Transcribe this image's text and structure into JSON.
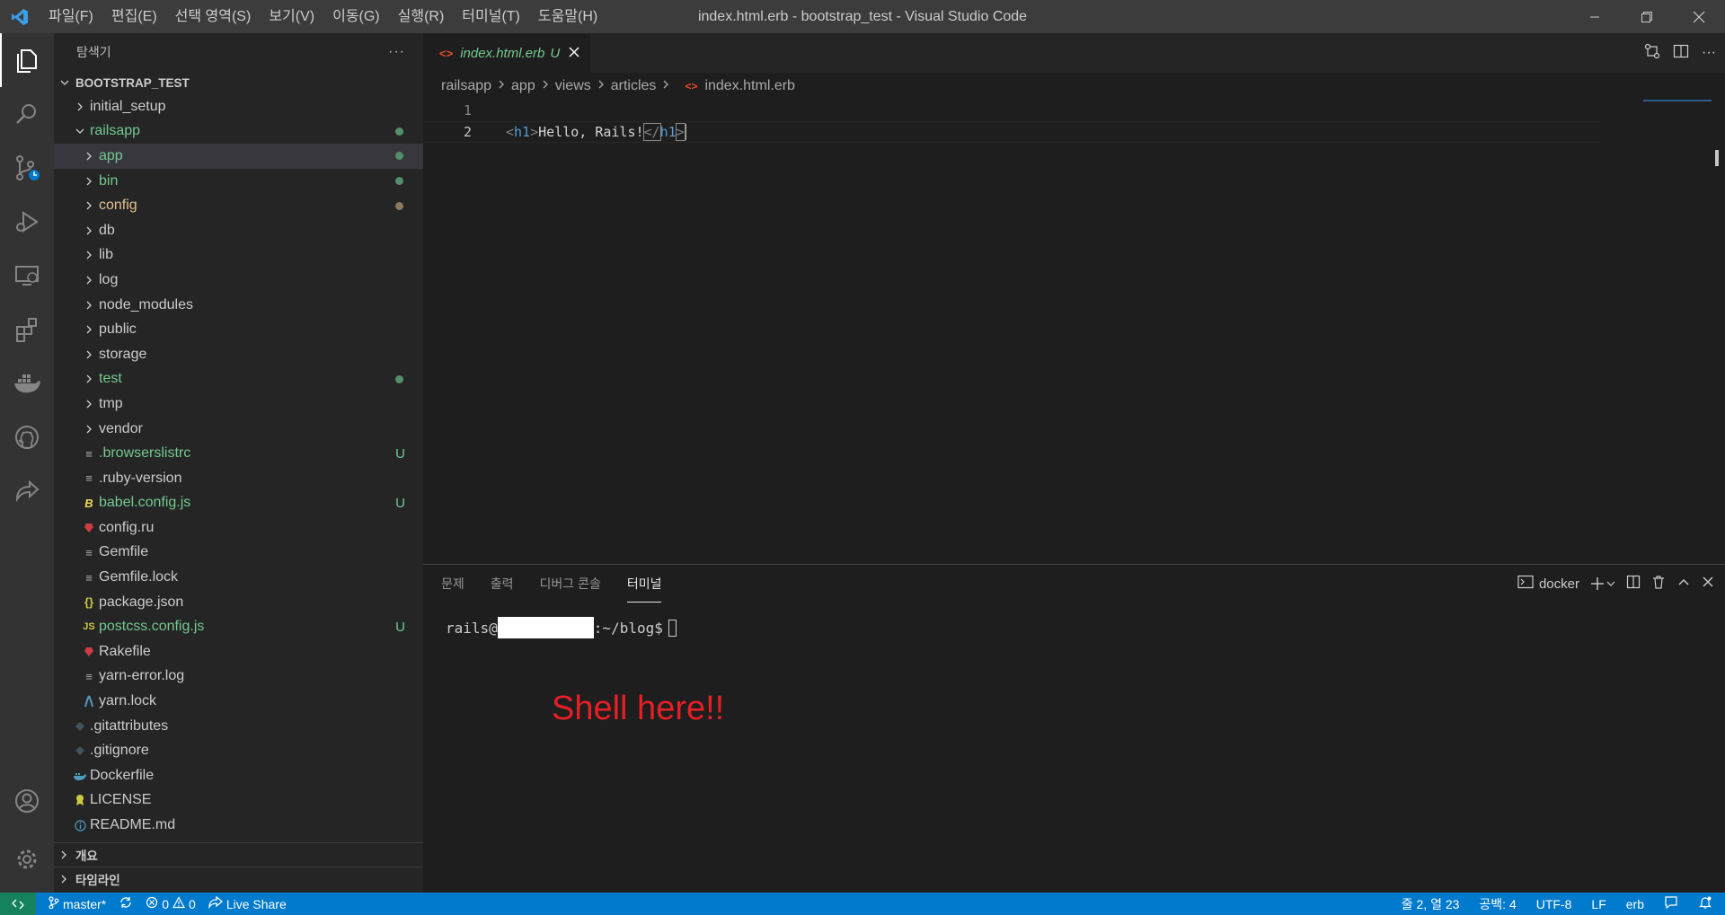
{
  "menu": [
    "파일(F)",
    "편집(E)",
    "선택 영역(S)",
    "보기(V)",
    "이동(G)",
    "실행(R)",
    "터미널(T)",
    "도움말(H)"
  ],
  "window_title": "index.html.erb - bootstrap_test - Visual Studio Code",
  "sidebar": {
    "header": "탐색기",
    "more": "···",
    "root": "BOOTSTRAP_TEST",
    "items": [
      {
        "label": "initial_setup",
        "status": ""
      },
      {
        "label": "railsapp",
        "status": ""
      },
      {
        "label": "app",
        "status": ""
      },
      {
        "label": "bin",
        "status": ""
      },
      {
        "label": "config",
        "status": ""
      },
      {
        "label": "db",
        "status": ""
      },
      {
        "label": "lib",
        "status": ""
      },
      {
        "label": "log",
        "status": ""
      },
      {
        "label": "node_modules",
        "status": ""
      },
      {
        "label": "public",
        "status": ""
      },
      {
        "label": "storage",
        "status": ""
      },
      {
        "label": "test",
        "status": ""
      },
      {
        "label": "tmp",
        "status": ""
      },
      {
        "label": "vendor",
        "status": ""
      },
      {
        "label": ".browserslistrc",
        "status": "U"
      },
      {
        "label": ".ruby-version",
        "status": ""
      },
      {
        "label": "babel.config.js",
        "status": "U"
      },
      {
        "label": "config.ru",
        "status": ""
      },
      {
        "label": "Gemfile",
        "status": ""
      },
      {
        "label": "Gemfile.lock",
        "status": ""
      },
      {
        "label": "package.json",
        "status": ""
      },
      {
        "label": "postcss.config.js",
        "status": "U"
      },
      {
        "label": "Rakefile",
        "status": ""
      },
      {
        "label": "yarn-error.log",
        "status": ""
      },
      {
        "label": "yarn.lock",
        "status": ""
      },
      {
        "label": ".gitattributes",
        "status": ""
      },
      {
        "label": ".gitignore",
        "status": ""
      },
      {
        "label": "Dockerfile",
        "status": ""
      },
      {
        "label": "LICENSE",
        "status": ""
      },
      {
        "label": "README.md",
        "status": ""
      }
    ],
    "outline": "개요",
    "timeline": "타임라인"
  },
  "editor": {
    "tab_label": "index.html.erb",
    "tab_status": "U",
    "breadcrumbs": [
      "railsapp",
      "app",
      "views",
      "articles",
      "index.html.erb"
    ],
    "lines": [
      {
        "num": "1",
        "text": ""
      },
      {
        "num": "2",
        "open_b1": "<",
        "open_tag": "h1",
        "open_b2": ">",
        "content": "Hello, Rails!",
        "close_b1": "</",
        "close_tag": "h1",
        "close_b2": ">"
      }
    ]
  },
  "panel": {
    "tabs": [
      "문제",
      "출력",
      "디버그 콘솔",
      "터미널"
    ],
    "terminal_name": "docker",
    "prompt_user": "rails@",
    "prompt_path": ":~/blog$",
    "annotation": "Shell here!!"
  },
  "status": {
    "branch": "master*",
    "errors": "0",
    "warnings": "0",
    "live_share": "Live Share",
    "position": "줄 2, 열 23",
    "spaces": "공백: 4",
    "encoding": "UTF-8",
    "eol": "LF",
    "language": "erb"
  },
  "colors": {
    "accent": "#007acc",
    "git_untracked": "#73c991",
    "git_modified": "#e2c08d",
    "annotation": "#e51f25"
  }
}
